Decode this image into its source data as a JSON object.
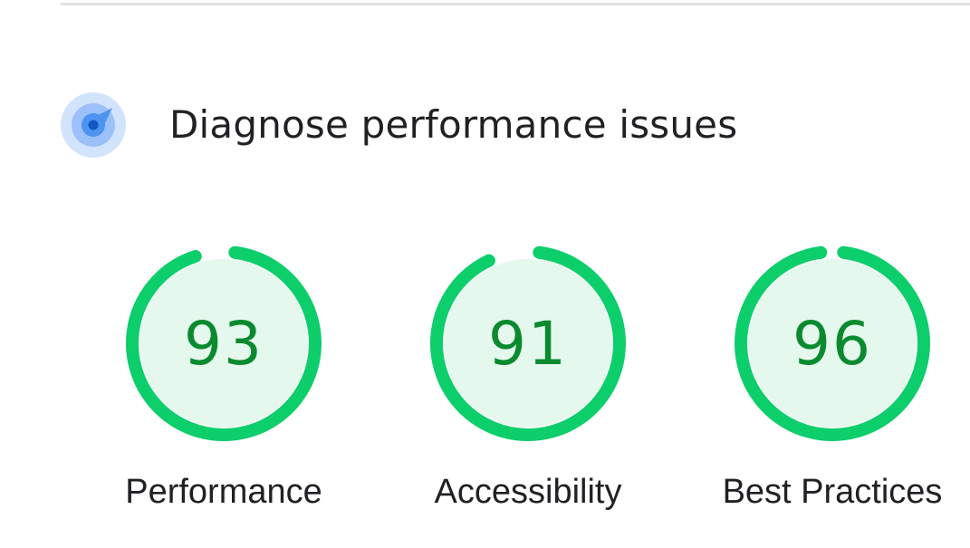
{
  "section": {
    "title": "Diagnose performance issues",
    "icon": "lighthouse-compass-icon"
  },
  "gauges": [
    {
      "label": "Performance",
      "score": "93",
      "value": 93
    },
    {
      "label": "Accessibility",
      "score": "91",
      "value": 91
    },
    {
      "label": "Best Practices",
      "score": "96",
      "value": 96
    }
  ],
  "colors": {
    "pass_arc": "#0cce6b",
    "pass_fill": "#e5f8ed",
    "pass_text": "#0a8a2e",
    "icon_outer": "#d2e3fc",
    "icon_inner": "#8ab4f8",
    "icon_core": "#1a73e8"
  }
}
